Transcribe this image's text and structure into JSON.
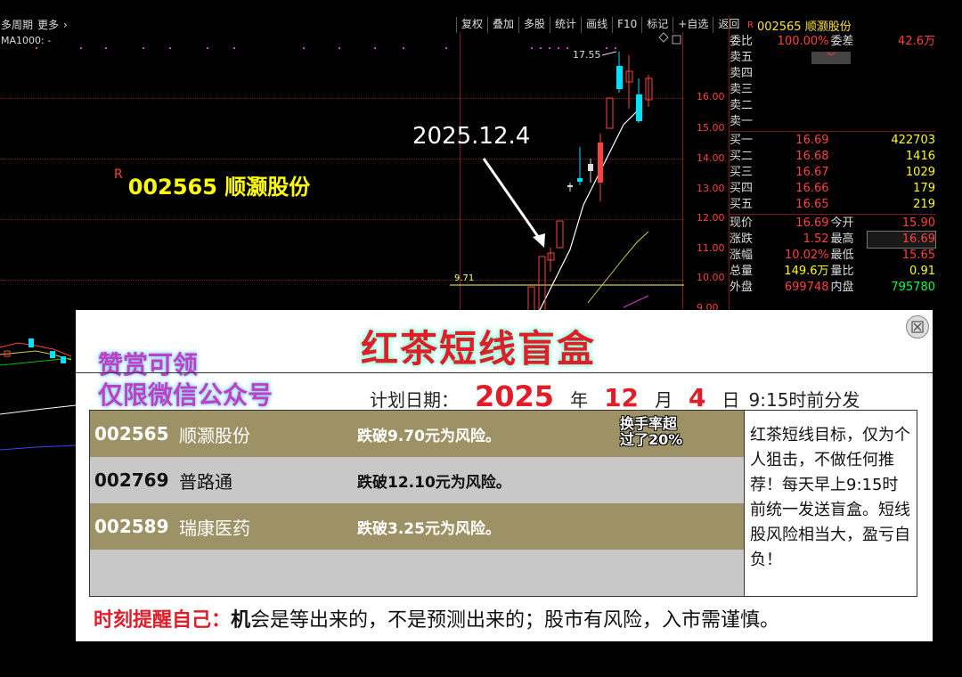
{
  "header": {
    "period_label": "多周期",
    "more_label": "更多",
    "ma_label": "MA1000: -",
    "toolbar": [
      "复权",
      "叠加",
      "多股",
      "统计",
      "画线",
      "F10",
      "标记",
      "+自选",
      "返回"
    ]
  },
  "chart": {
    "y_ticks": [
      "16.00",
      "15.00",
      "14.00",
      "13.00",
      "12.00",
      "11.00",
      "10.00",
      "9.00"
    ],
    "annotation_date": "2025.12.4",
    "annotation_stock_mark": "R",
    "annotation_stock": "002565 顺灏股份",
    "high_label": "17.55",
    "level_label": "9.71"
  },
  "quote": {
    "mark": "R",
    "title": "002565 顺灏股份",
    "ratio_label": "委比",
    "ratio": "100.00%",
    "diff_label": "委差",
    "diff": "42.6万",
    "asks": [
      "卖五",
      "卖四",
      "卖三",
      "卖二",
      "卖一"
    ],
    "bids": [
      {
        "label": "买一",
        "price": "16.69",
        "vol": "422703"
      },
      {
        "label": "买二",
        "price": "16.68",
        "vol": "1416"
      },
      {
        "label": "买三",
        "price": "16.67",
        "vol": "1029"
      },
      {
        "label": "买四",
        "price": "16.66",
        "vol": "179"
      },
      {
        "label": "买五",
        "price": "16.65",
        "vol": "219"
      }
    ],
    "stats": [
      {
        "l1": "现价",
        "v1": "16.69",
        "l2": "今开",
        "v2": "15.90"
      },
      {
        "l1": "涨跌",
        "v1": "1.52",
        "l2": "最高",
        "v2": "16.69"
      },
      {
        "l1": "涨幅",
        "v1": "10.02%",
        "l2": "最低",
        "v2": "15.65"
      },
      {
        "l1": "总量",
        "v1": "149.6万",
        "l2": "量比",
        "v2": "0.91"
      },
      {
        "l1": "外盘",
        "v1": "699748",
        "l2": "内盘",
        "v2": "795780"
      }
    ]
  },
  "card": {
    "title": "红茶短线盲盒",
    "promo_line1": "赞赏可领",
    "promo_line2": "仅限微信公众号",
    "plan_label": "计划日期：",
    "year": "2025",
    "year_unit": "年",
    "month": "12",
    "month_unit": "月",
    "day": "4",
    "day_unit": "日",
    "time_text": "9:15时前分发",
    "turnover_line1": "换手率超",
    "turnover_line2": "过了20%",
    "picks": [
      {
        "code": "002565",
        "name": "顺灏股份",
        "risk": "跌破9.70元为风险。"
      },
      {
        "code": "002769",
        "name": "普路通",
        "risk": "跌破12.10元为风险。"
      },
      {
        "code": "002589",
        "name": "瑞康医药",
        "risk": "跌破3.25元为风险。"
      }
    ],
    "note": "红茶短线目标，仅为个人狙击，不做任何推荐！每天早上9:15时前统一发送盲盒。短线股风险相当大，盈亏自负！",
    "footer_red": "时刻提醒自己：",
    "footer_bold": "机",
    "footer_rest": "会是等出来的，不是预测出来的；股市有风险，入市需谨慎。"
  }
}
